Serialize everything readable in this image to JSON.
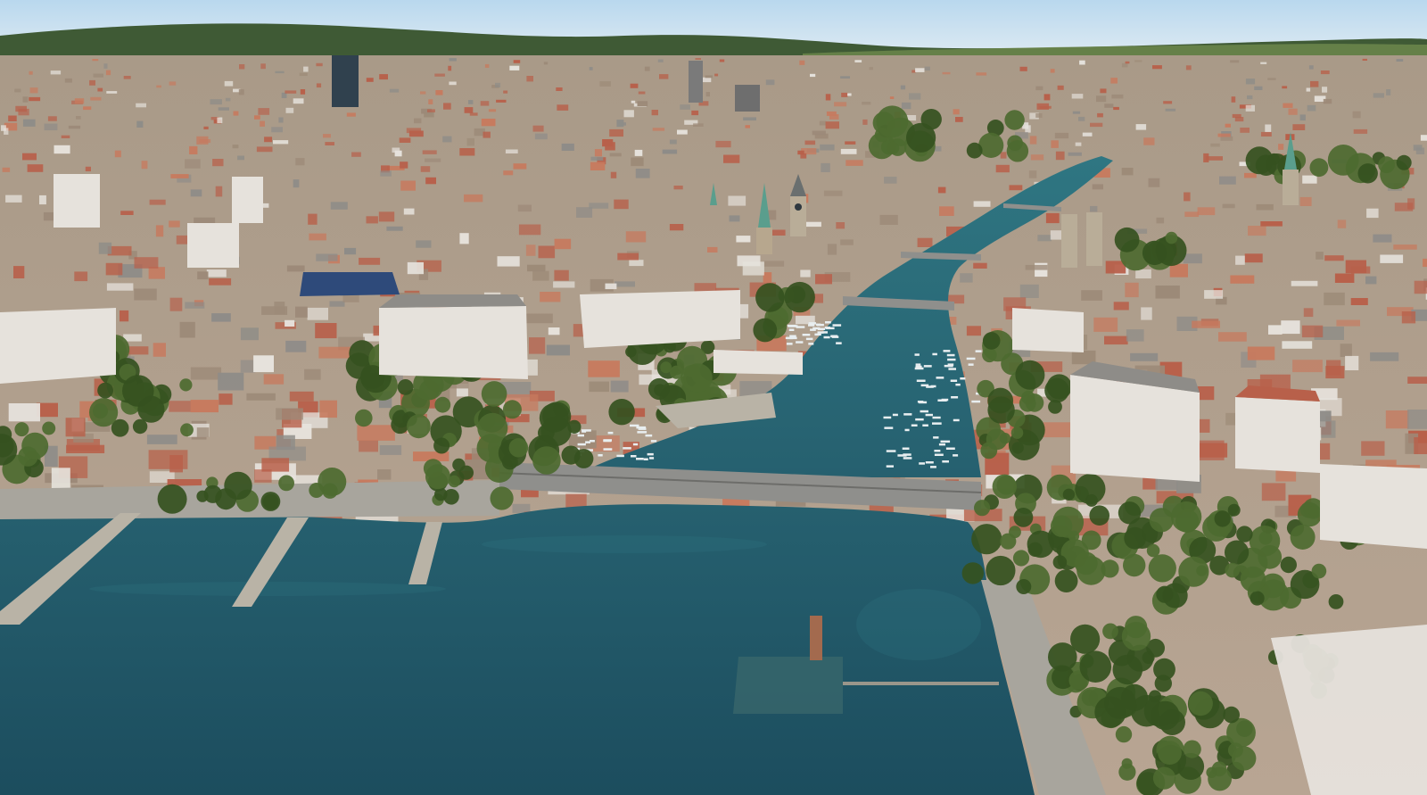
{
  "scene": {
    "view": "3d-aerial-map",
    "colors": {
      "sky_top": "#b9d8ee",
      "sky_bottom": "#dbe9f2",
      "hills": "#3f5a35",
      "hills_light": "#6f8a4e",
      "city_far": "#a99a88",
      "city_mid": "#b8a593",
      "roof_red": "#b8604a",
      "roof_grey": "#8e8c88",
      "building_light": "#e6e2dc",
      "water_deep": "#1c4d5e",
      "water_mid": "#26606f",
      "water_light": "#2f7682",
      "tree": "#4d6a30",
      "tree_dark": "#35511f",
      "bridge": "#8f8f8c",
      "pier": "#b9b3a6",
      "promenade": "#a8a59d"
    }
  }
}
